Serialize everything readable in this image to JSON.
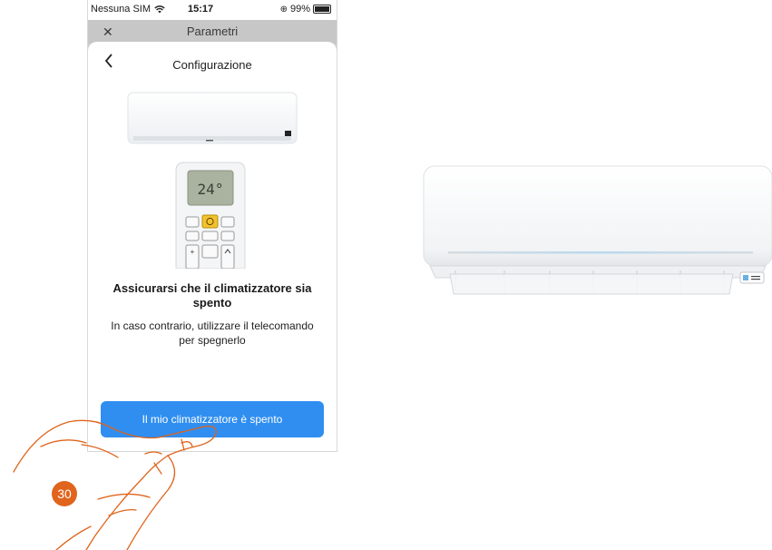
{
  "status_bar": {
    "carrier": "Nessuna SIM",
    "wifi_icon": "wifi-icon",
    "time": "15:17",
    "battery": "99%"
  },
  "background_screen": {
    "title": "Parametri",
    "close_icon": "close-icon"
  },
  "sheet": {
    "title": "Configurazione",
    "back_icon": "chevron-left-icon",
    "remote_display": "24°",
    "heading": "Assicurarsi che il climatizzatore sia spento",
    "description": "In caso contrario, utilizzare il telecomando per spegnerlo",
    "primary_button": "Il mio climatizzatore è spento"
  },
  "step_badge": "30",
  "colors": {
    "primary": "#2f8ef0",
    "badge": "#e0641c",
    "power_button": "#f2c22e"
  }
}
